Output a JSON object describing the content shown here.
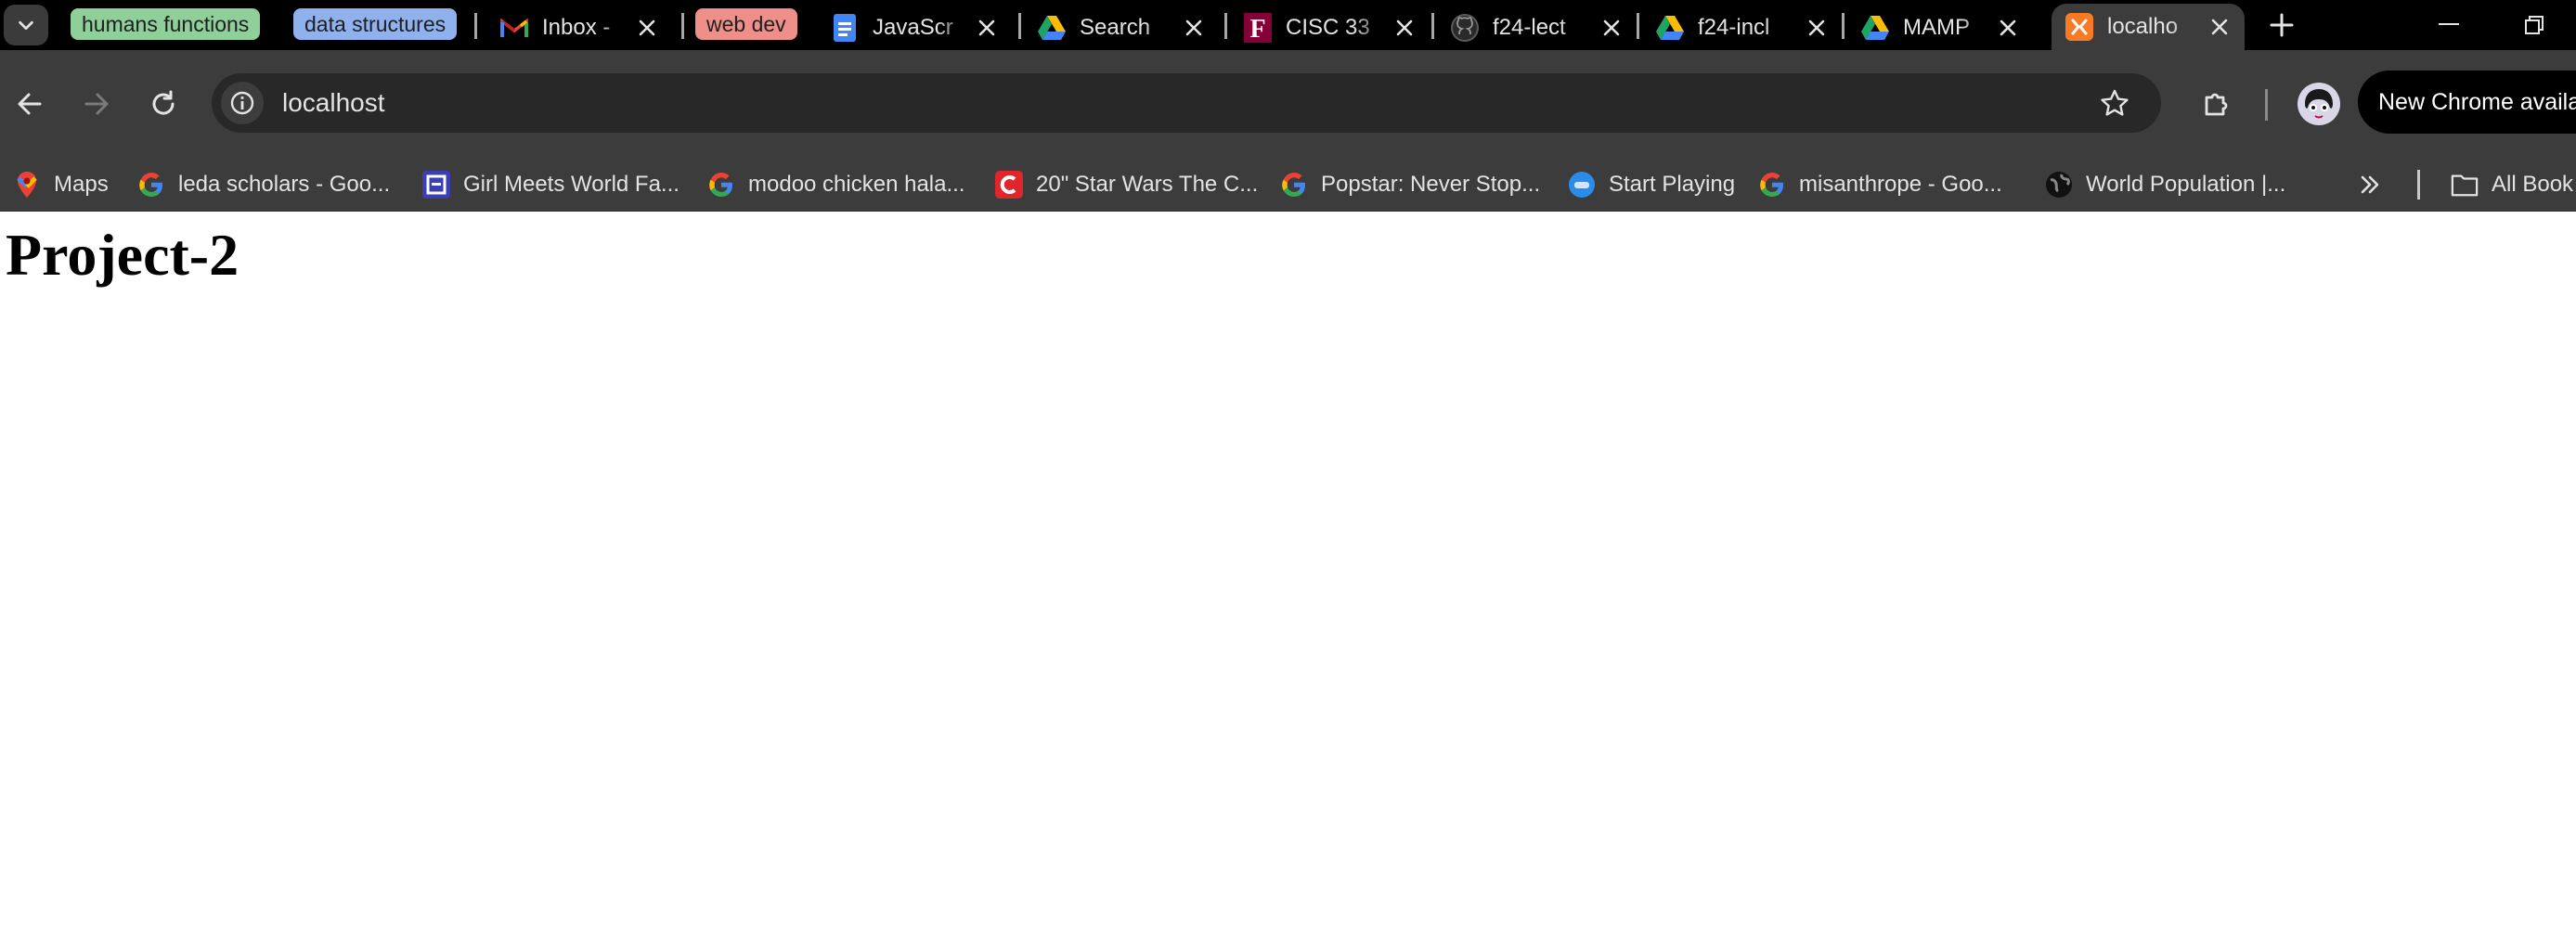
{
  "browser": {
    "tab_groups": [
      {
        "label": "humans functions",
        "color": "#8fcf9a"
      },
      {
        "label": "data structures",
        "color": "#8fb1ee"
      },
      {
        "label": "web dev",
        "color": "#ef8f8a"
      }
    ],
    "tabs": [
      {
        "title": "Inbox -",
        "icon": "gmail-icon"
      },
      {
        "title": "JavaScr",
        "icon": "google-docs-icon"
      },
      {
        "title": "Search",
        "icon": "google-drive-icon"
      },
      {
        "title": "CISC 33",
        "icon": "fordham-icon"
      },
      {
        "title": "f24-lect",
        "icon": "github-icon"
      },
      {
        "title": "f24-incl",
        "icon": "google-drive-icon"
      },
      {
        "title": "MAMP",
        "icon": "google-drive-icon"
      },
      {
        "title": "localho",
        "icon": "xampp-icon",
        "active": true
      }
    ],
    "address_bar": {
      "url": "localhost"
    },
    "promo": {
      "text": "New Chrome availab"
    },
    "bookmarks": [
      {
        "label": "Maps",
        "icon": "google-maps-icon"
      },
      {
        "label": "leda scholars - Goo...",
        "icon": "google-icon"
      },
      {
        "label": "Girl Meets World Fa...",
        "icon": "fandom-icon"
      },
      {
        "label": "modoo chicken hala...",
        "icon": "google-icon"
      },
      {
        "label": "20\" Star Wars The C...",
        "icon": "comicvine-icon"
      },
      {
        "label": "Popstar: Never Stop...",
        "icon": "google-icon"
      },
      {
        "label": "Start Playing",
        "icon": "game-icon"
      },
      {
        "label": "misanthrope - Goo...",
        "icon": "google-icon"
      },
      {
        "label": "World Population |...",
        "icon": "globe-icon"
      }
    ],
    "all_bookmarks_label": "All Book"
  },
  "page": {
    "heading": "Project-2"
  }
}
